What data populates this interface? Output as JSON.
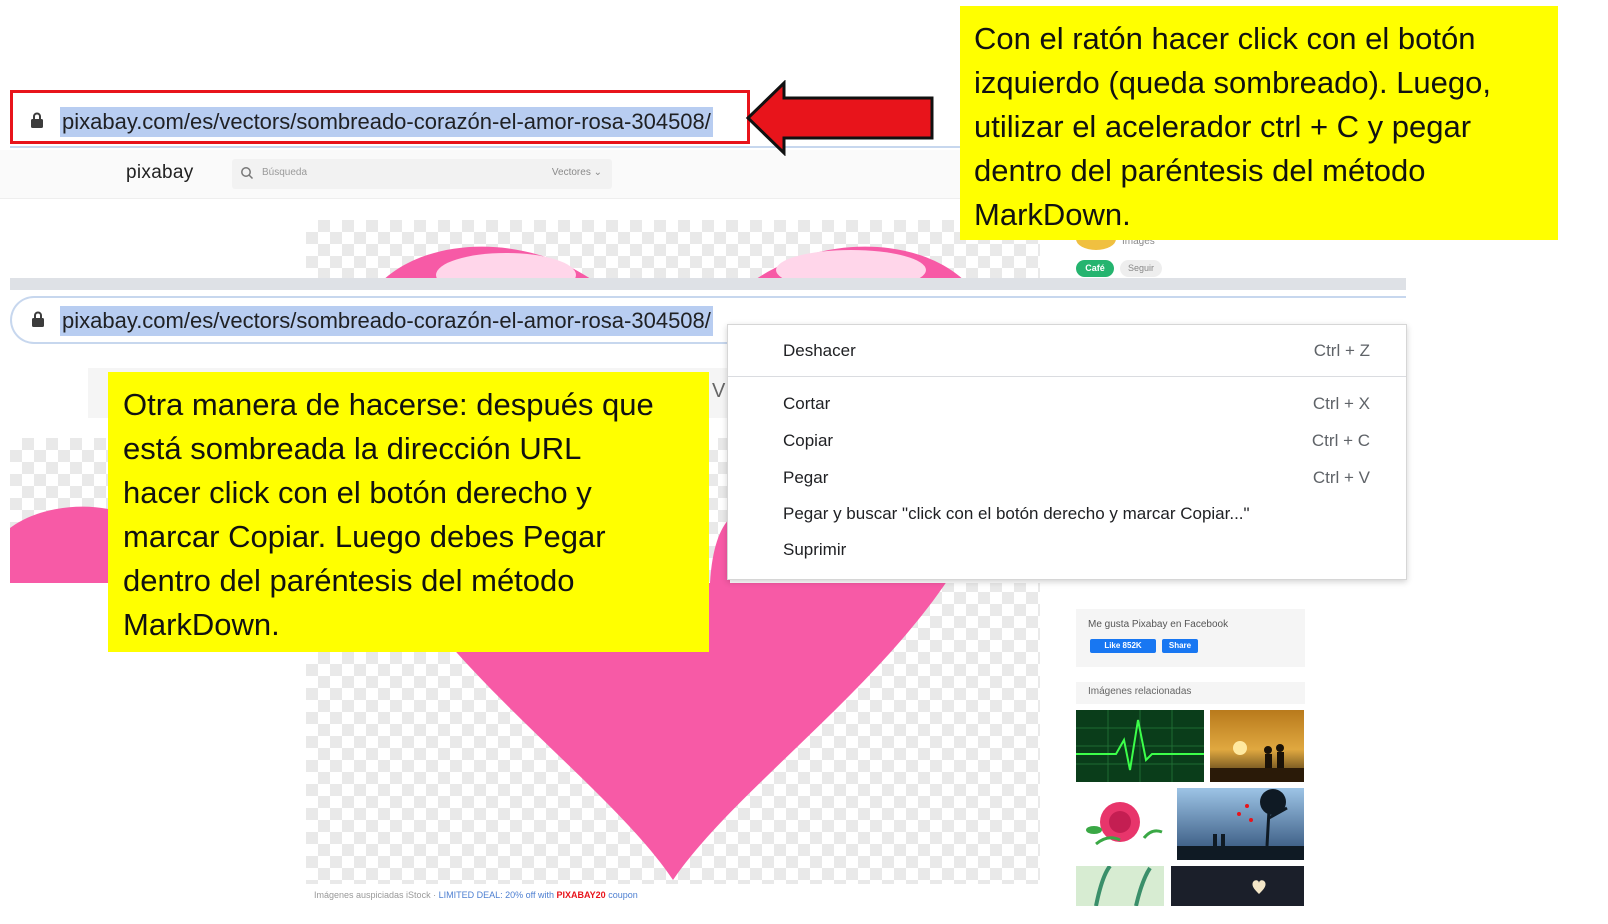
{
  "address_bar": {
    "url": "pixabay.com/es/vectors/sombreado-corazón-el-amor-rosa-304508/"
  },
  "pixabay": {
    "logo": "pixabay",
    "search_placeholder": "Búsqueda",
    "search_type": "Vectores"
  },
  "sidebar": {
    "images_label": "Images",
    "cafe_button": "Café",
    "follow_button": "Seguir",
    "facebook_label": "Me gusta Pixabay en Facebook",
    "like_button": "Like 852K",
    "share_button": "Share",
    "related_label": "Imágenes relacionadas"
  },
  "sponsor": {
    "prefix": "Imágenes auspiciadas iStock ·",
    "deal": "LIMITED DEAL: 20% off with",
    "code": "PIXABAY20",
    "suffix": "coupon"
  },
  "second_screen": {
    "search_fragment": "V"
  },
  "context_menu": {
    "items": [
      {
        "label": "Deshacer",
        "shortcut": "Ctrl + Z"
      },
      {
        "label": "Cortar",
        "shortcut": "Ctrl + X"
      },
      {
        "label": "Copiar",
        "shortcut": "Ctrl + C"
      },
      {
        "label": "Pegar",
        "shortcut": "Ctrl + V"
      },
      {
        "label": "Pegar y buscar \"click con el botón derecho y marcar Copiar...\"",
        "shortcut": ""
      },
      {
        "label": "Suprimir",
        "shortcut": ""
      }
    ]
  },
  "callouts": {
    "top": [
      "Con el ratón hacer click con el botón",
      "izquierdo  (queda sombreado). Luego,",
      "utilizar el acelerador ctrl + C y pegar",
      "dentro del paréntesis del método",
      "MarkDown."
    ],
    "bottom": [
      "Otra manera de hacerse: después que",
      "está sombreada la dirección URL",
      "hacer click con el botón derecho y",
      "marcar Copiar. Luego  debes Pegar",
      "dentro del paréntesis del método",
      "MarkDown."
    ]
  },
  "colors": {
    "highlight": "#b8cdf1",
    "callout": "#ffff00",
    "arrow": "#e8141b",
    "heart": "#f75aa6"
  }
}
